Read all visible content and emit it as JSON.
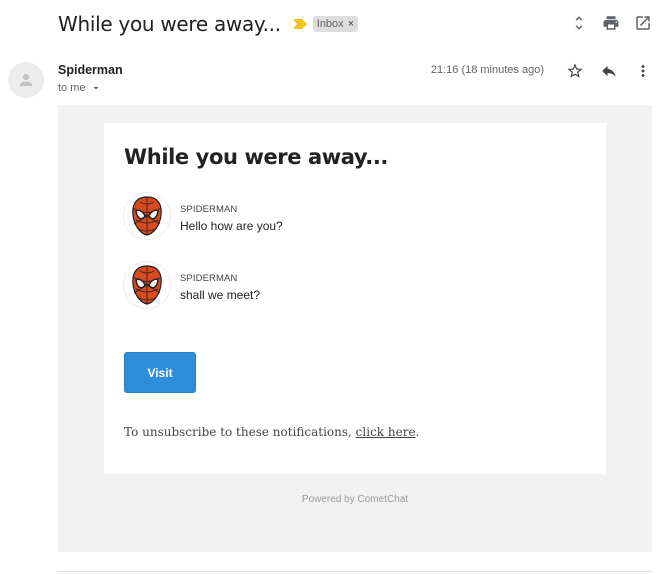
{
  "header": {
    "subject": "While you were away...",
    "label": "Inbox",
    "label_close": "×"
  },
  "sender": {
    "name": "Spiderman",
    "to": "to me",
    "timestamp": "21:16 (18 minutes ago)"
  },
  "email": {
    "title": "While you were away...",
    "messages": [
      {
        "sender": "SPIDERMAN",
        "text": "Hello how are you?"
      },
      {
        "sender": "SPIDERMAN",
        "text": "shall we meet?"
      }
    ],
    "visit_label": "Visit",
    "unsubscribe_prefix": "To unsubscribe to these notifications, ",
    "unsubscribe_link": "click here",
    "unsubscribe_suffix": ".",
    "powered_by": "Powered by CometChat"
  },
  "colors": {
    "accent": "#2f8ed9",
    "importance": "#f2c31a",
    "email_background": "#f2f2f2"
  },
  "icons": {
    "top": [
      "expand-collapse-icon",
      "print-icon",
      "open-in-new-icon"
    ],
    "message": [
      "star-icon",
      "reply-icon",
      "more-vert-icon"
    ]
  }
}
